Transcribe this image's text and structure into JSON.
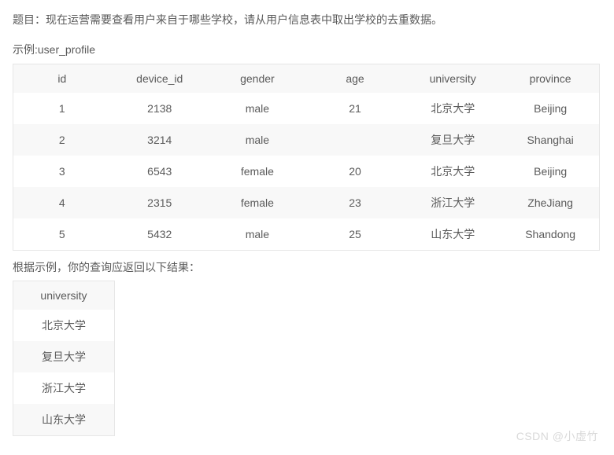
{
  "question": "题目：现在运营需要查看用户来自于哪些学校，请从用户信息表中取出学校的去重数据。",
  "example_label": "示例:user_profile",
  "main_table": {
    "headers": [
      "id",
      "device_id",
      "gender",
      "age",
      "university",
      "province"
    ],
    "rows": [
      [
        "1",
        "2138",
        "male",
        "21",
        "北京大学",
        "Beijing"
      ],
      [
        "2",
        "3214",
        "male",
        "",
        "复旦大学",
        "Shanghai"
      ],
      [
        "3",
        "6543",
        "female",
        "20",
        "北京大学",
        "Beijing"
      ],
      [
        "4",
        "2315",
        "female",
        "23",
        "浙江大学",
        "ZheJiang"
      ],
      [
        "5",
        "5432",
        "male",
        "25",
        "山东大学",
        "Shandong"
      ]
    ]
  },
  "result_label": "根据示例，你的查询应返回以下结果：",
  "result_table": {
    "headers": [
      "university"
    ],
    "rows": [
      [
        "北京大学"
      ],
      [
        "复旦大学"
      ],
      [
        "浙江大学"
      ],
      [
        "山东大学"
      ]
    ]
  },
  "watermark": "CSDN @小虚竹"
}
